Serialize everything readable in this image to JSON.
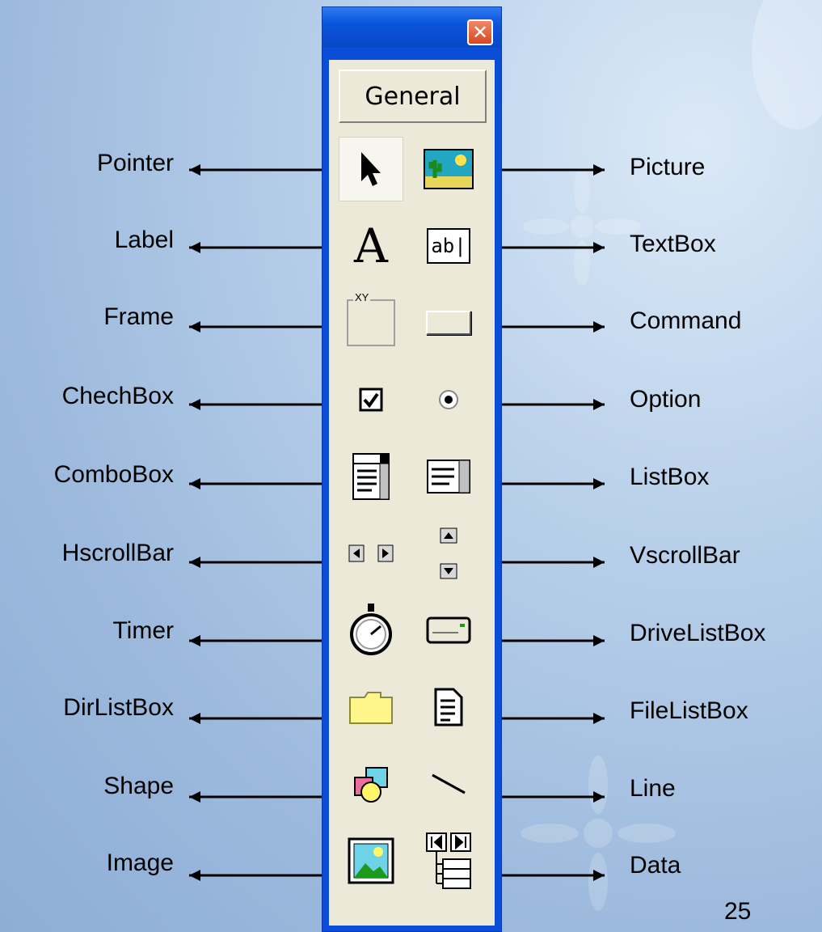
{
  "toolbox": {
    "close_glyph": "✕",
    "tab_label": "General"
  },
  "left_labels": [
    "Pointer",
    "Label",
    "Frame",
    "ChechBox",
    "ComboBox",
    "HscrollBar",
    "Timer",
    "DirListBox",
    "Shape",
    "Image"
  ],
  "right_labels": [
    "Picture",
    "TextBox",
    "Command",
    "Option",
    "ListBox",
    "VscrollBar",
    "DriveListBox",
    "FileListBox",
    "Line",
    "Data"
  ],
  "tools_left": [
    "pointer-icon",
    "label-icon",
    "frame-icon",
    "checkbox-icon",
    "combobox-icon",
    "hscrollbar-icon",
    "timer-icon",
    "dirlistbox-icon",
    "shape-icon",
    "image-icon"
  ],
  "tools_right": [
    "picture-icon",
    "textbox-icon",
    "command-button-icon",
    "option-button-icon",
    "listbox-icon",
    "vscrollbar-icon",
    "drivelistbox-icon",
    "filelistbox-icon",
    "line-icon",
    "data-icon"
  ],
  "icon_text": {
    "label": "A",
    "textbox": "ab|",
    "frame": "XY"
  },
  "page_number": "25",
  "colors": {
    "window_blue": "#0a4ed8",
    "toolbox_face": "#ece9d8",
    "close_red": "#d9451f"
  }
}
